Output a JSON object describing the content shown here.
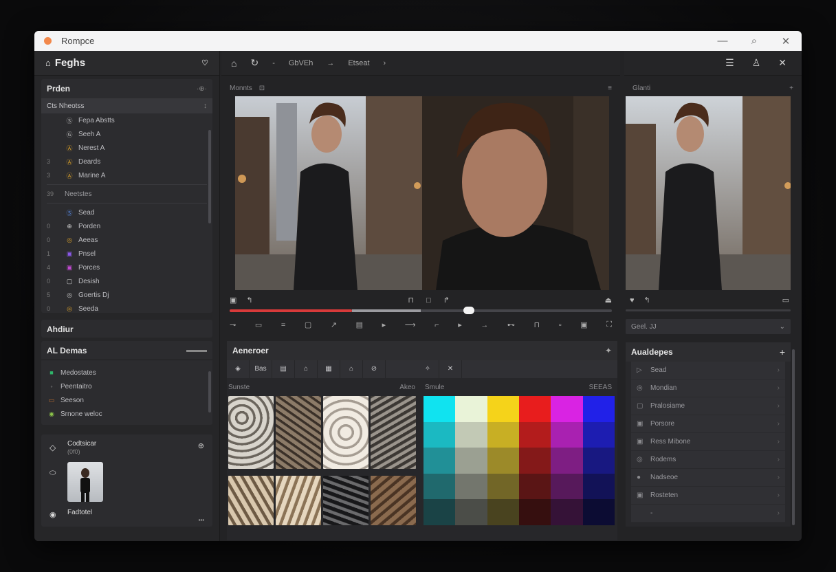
{
  "window": {
    "title": "Rompce"
  },
  "left": {
    "header": "Feghs",
    "panel1": {
      "title": "Prden",
      "subheader": "Cts Nheotss",
      "group1": [
        {
          "n": "",
          "icon": "Ⓢ",
          "label": "Fepa Abstts"
        },
        {
          "n": "",
          "icon": "Ⓖ",
          "label": "Seeh A"
        },
        {
          "n": "",
          "icon": "Ⓐ",
          "label": "Nerest A"
        },
        {
          "n": "3",
          "icon": "Ⓐ",
          "label": "Deards"
        },
        {
          "n": "3",
          "icon": "Ⓐ",
          "label": "Marine A"
        }
      ],
      "group2label": "Neetstes",
      "group2": [
        {
          "n": "",
          "icon": "Ⓢ",
          "label": "Sead"
        },
        {
          "n": "0",
          "icon": "⊕",
          "label": "Porden"
        },
        {
          "n": "0",
          "icon": "◎",
          "label": "Aeeas"
        },
        {
          "n": "1",
          "icon": "▣",
          "label": "Pnsel"
        },
        {
          "n": "4",
          "icon": "▣",
          "label": "Porces"
        },
        {
          "n": "0",
          "icon": "▢",
          "label": "Desish"
        },
        {
          "n": "5",
          "icon": "◎",
          "label": "Goertis Dj"
        },
        {
          "n": "0",
          "icon": "◎",
          "label": "Seeda"
        }
      ]
    },
    "panel2": {
      "title": "Ahdiur"
    },
    "panel3": {
      "title": "AL Demas",
      "items": [
        "Medostates",
        "Peentaitro",
        "Seeson",
        "Srnone weloc"
      ]
    },
    "panel4": {
      "title": "Codtsicar",
      "subtitle": "(0f0)",
      "caption": "Fadtotel",
      "more": "•••"
    }
  },
  "toolbar": {
    "crumbs": [
      "GbVEh",
      "Etseat"
    ]
  },
  "center": {
    "viewer_label": "Monnts",
    "assets_title": "Aeneroer",
    "asset_tabs": [
      "◈",
      "Bas",
      "▤",
      "⌂",
      "▦",
      "⌂",
      "⊘"
    ],
    "sample_label": "Sunste",
    "sample_right": "Akeo",
    "swatch_label": "Smule",
    "swatch_right": "SEEAS"
  },
  "right": {
    "viewer_label": "Glanti",
    "select": "Geel. JJ",
    "assets_title": "Aualdepes",
    "items": [
      {
        "icon": "▷",
        "label": "Sead"
      },
      {
        "icon": "◎",
        "label": "Mondian"
      },
      {
        "icon": "▢",
        "label": "Pralosiame"
      },
      {
        "icon": "▣",
        "label": "Porsore"
      },
      {
        "icon": "▣",
        "label": "Ress Mibone"
      },
      {
        "icon": "◎",
        "label": "Rodems"
      },
      {
        "icon": "●",
        "label": "Nadseoe"
      },
      {
        "icon": "▣",
        "label": "Rosteten"
      },
      {
        "icon": "",
        "label": "-"
      }
    ]
  },
  "colors": {
    "accent": "#d83a3a",
    "window_dot": "#f2884b"
  }
}
